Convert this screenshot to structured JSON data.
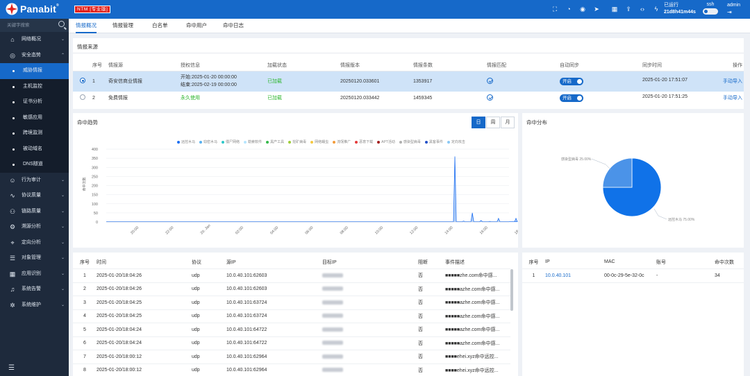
{
  "brand": {
    "name": "Panabit",
    "reg": "®",
    "edition": "NTM [专业版]"
  },
  "header": {
    "tools": [
      "fullscreen-icon",
      "dashboard-icon",
      "eye-icon",
      "send-icon",
      "layout-icon",
      "upload-icon",
      "code-icon",
      "bolt-icon"
    ],
    "uptime_label": "已运行",
    "uptime_value": "21d8h41m44s",
    "ssh_label": "ssh",
    "user": "admin",
    "logout_icon": "logout-icon"
  },
  "sidebar": {
    "search_placeholder": "关键字搜索",
    "items": [
      {
        "label": "网络概况",
        "icon": "home-icon"
      },
      {
        "label": "安全态势",
        "icon": "shield-icon"
      },
      {
        "label": "威胁情报"
      },
      {
        "label": "主机监控"
      },
      {
        "label": "证书分析"
      },
      {
        "label": "敏感应用"
      },
      {
        "label": "跨境监测"
      },
      {
        "label": "被动域名"
      },
      {
        "label": "DNS隧道"
      },
      {
        "label": "行为审计",
        "icon": "user-icon"
      },
      {
        "label": "协议质量",
        "icon": "pulse-icon"
      },
      {
        "label": "链路质量",
        "icon": "link-icon"
      },
      {
        "label": "溯源分析",
        "icon": "trace-icon"
      },
      {
        "label": "定向分析",
        "icon": "location-icon"
      },
      {
        "label": "对象管理",
        "icon": "list-icon"
      },
      {
        "label": "应用识别",
        "icon": "apps-icon"
      },
      {
        "label": "系统告警",
        "icon": "bell-icon"
      },
      {
        "label": "系统维护",
        "icon": "gear-icon"
      }
    ],
    "collapse_icon": "menu-collapse-icon"
  },
  "tabs": [
    "情报概况",
    "情报管理",
    "白名单",
    "命中用户",
    "命中日志"
  ],
  "sources": {
    "title": "情报来源",
    "columns": [
      "序号",
      "情报源",
      "授权信息",
      "加载状态",
      "情报版本",
      "情报条数",
      "情报匹配",
      "自动同步",
      "同步时间",
      "操作"
    ],
    "rows": [
      {
        "no": "1",
        "name": "奇安信商业情报",
        "auth_start": "开始:2025-01-20 00:00:00",
        "auth_end": "结束:2025-02-19 00:00:00",
        "status": "已加载",
        "version": "20250120.033601",
        "count": "1353917",
        "sync": "开启",
        "sync_time": "2025-01-20 17:51:07",
        "action": "手动导入"
      },
      {
        "no": "2",
        "name": "免费情报",
        "auth_start": "永久使用",
        "auth_end": "",
        "status": "已加载",
        "version": "20250120.033442",
        "count": "1459345",
        "sync": "开启",
        "sync_time": "2025-01-20 17:51:25",
        "action": "手动导入"
      }
    ]
  },
  "trend": {
    "title": "命中趋势",
    "ranges": [
      "日",
      "周",
      "月"
    ],
    "legend": [
      {
        "name": "远控木马",
        "color": "#1e6ff2"
      },
      {
        "name": "窃密木马",
        "color": "#5ab1ef"
      },
      {
        "name": "僵尸网络",
        "color": "#2ec7c9"
      },
      {
        "name": "勒索软件",
        "color": "#b6e6ff"
      },
      {
        "name": "黑产工具",
        "color": "#35b94b"
      },
      {
        "name": "挖矿病毒",
        "color": "#9ecd39"
      },
      {
        "name": "网络蠕虫",
        "color": "#f5c842"
      },
      {
        "name": "流氓推广",
        "color": "#f39c3b"
      },
      {
        "name": "恶意下载",
        "color": "#e53a3a"
      },
      {
        "name": "APT活动",
        "color": "#a32121"
      },
      {
        "name": "感染型病毒",
        "color": "#b0b0b0"
      },
      {
        "name": "黑客事件",
        "color": "#2350c8"
      },
      {
        "name": "定向攻击",
        "color": "#8bc8f5"
      }
    ],
    "ylabel": "命中次数"
  },
  "chart_data": [
    {
      "type": "area",
      "title": "命中趋势",
      "ylabel": "命中次数",
      "ylim": [
        0,
        400
      ],
      "yticks": [
        0,
        50,
        100,
        150,
        200,
        250,
        300,
        350,
        400
      ],
      "xticks": [
        "20:00",
        "22:00",
        "20. Jan",
        "02:00",
        "04:00",
        "06:00",
        "08:00",
        "10:00",
        "12:00",
        "14:00",
        "16:00",
        "18:00"
      ],
      "grid": true,
      "legend_position": "top-right",
      "series": [
        {
          "name": "远控木马",
          "x": [
            "14:00",
            "14:30",
            "15:00",
            "15:30",
            "16:00",
            "16:30",
            "17:00",
            "17:30",
            "18:00"
          ],
          "values": [
            2,
            360,
            5,
            50,
            8,
            3,
            20,
            2,
            20
          ]
        }
      ]
    },
    {
      "type": "pie",
      "title": "命中分布",
      "slices": [
        {
          "name": "远控木马",
          "value": 75.0,
          "color": "#1072e8"
        },
        {
          "name": "感染型病毒",
          "value": 25.0,
          "color": "#4b93e8"
        }
      ]
    }
  ],
  "distribution": {
    "title": "命中分布",
    "labels": [
      "感染型病毒 25.00%",
      "远控木马 75.00%"
    ]
  },
  "events": {
    "columns": [
      "序号",
      "时间",
      "协议",
      "源IP",
      "目标IP",
      "阻断",
      "事件描述"
    ],
    "rows": [
      {
        "no": "1",
        "time": "2025-01-20/18:04:26",
        "proto": "udp",
        "src": "10.0.40.101:62603",
        "block": "否",
        "desc": "■■■■■zhe.com命中感..."
      },
      {
        "no": "2",
        "time": "2025-01-20/18:04:26",
        "proto": "udp",
        "src": "10.0.40.101:62603",
        "block": "否",
        "desc": "■■■■■azhe.com命中感..."
      },
      {
        "no": "3",
        "time": "2025-01-20/18:04:25",
        "proto": "udp",
        "src": "10.0.40.101:63724",
        "block": "否",
        "desc": "■■■■■azhe.com命中感..."
      },
      {
        "no": "4",
        "time": "2025-01-20/18:04:25",
        "proto": "udp",
        "src": "10.0.40.101:63724",
        "block": "否",
        "desc": "■■■■■azhe.com命中感..."
      },
      {
        "no": "5",
        "time": "2025-01-20/18:04:24",
        "proto": "udp",
        "src": "10.0.40.101:64722",
        "block": "否",
        "desc": "■■■■■azhe.com命中感..."
      },
      {
        "no": "6",
        "time": "2025-01-20/18:04:24",
        "proto": "udp",
        "src": "10.0.40.101:64722",
        "block": "否",
        "desc": "■■■■■azhe.com命中感..."
      },
      {
        "no": "7",
        "time": "2025-01-20/18:00:12",
        "proto": "udp",
        "src": "10.0.40.101:62964",
        "block": "否",
        "desc": "■■■■ehei.xyz命中远控..."
      },
      {
        "no": "8",
        "time": "2025-01-20/18:00:12",
        "proto": "udp",
        "src": "10.0.40.101:62964",
        "block": "否",
        "desc": "■■■■ehei.xyz命中远控..."
      }
    ]
  },
  "hosts": {
    "columns": [
      "序号",
      "IP",
      "MAC",
      "账号",
      "命中次数"
    ],
    "rows": [
      {
        "no": "1",
        "ip": "10.0.40.101",
        "mac": "00-0c-29-5e-32-0c",
        "account": "-",
        "hits": "34"
      }
    ]
  }
}
